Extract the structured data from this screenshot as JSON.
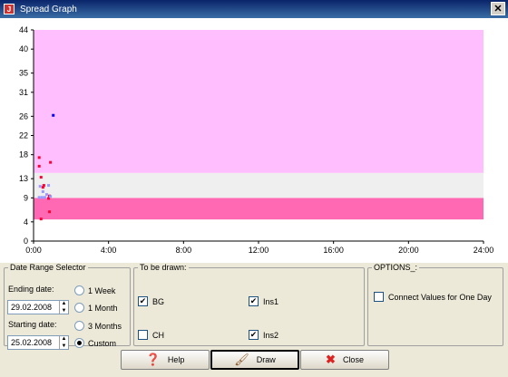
{
  "window": {
    "title": "Spread Graph",
    "app_icon": "java-cup-icon",
    "close_glyph": "✕"
  },
  "chart_data": {
    "type": "scatter",
    "title": "",
    "xlabel": "",
    "ylabel": "",
    "xlim": [
      0,
      24
    ],
    "ylim": [
      0,
      44
    ],
    "x_ticks": [
      "0:00",
      "4:00",
      "8:00",
      "12:00",
      "16:00",
      "20:00",
      "24:00"
    ],
    "y_ticks": [
      0,
      4,
      9,
      13,
      18,
      22,
      26,
      31,
      35,
      40,
      44
    ],
    "grid": false,
    "bands": [
      {
        "from": 0,
        "to": 4,
        "color": "#ffffff"
      },
      {
        "from": 4,
        "to": 4.5,
        "color": "#ffffff"
      },
      {
        "from": 4.5,
        "to": 9,
        "color": "#ff69b4"
      },
      {
        "from": 9,
        "to": 14.2,
        "color": "#efefef"
      },
      {
        "from": 14.2,
        "to": 44,
        "color": "#ffbfff"
      }
    ],
    "series": [
      {
        "color": "#ff0033",
        "points": [
          [
            0.3,
            17.4
          ],
          [
            0.3,
            15.6
          ],
          [
            0.4,
            13.3
          ],
          [
            0.5,
            11.2
          ],
          [
            0.55,
            11.6
          ],
          [
            0.9,
            16.4
          ],
          [
            0.8,
            8.9
          ],
          [
            0.85,
            6.1
          ],
          [
            0.4,
            4.6
          ],
          [
            0.85,
            9.4
          ]
        ]
      },
      {
        "color": "#9999ff",
        "points": [
          [
            0.35,
            11.4
          ],
          [
            0.5,
            10.3
          ],
          [
            0.3,
            9.1
          ],
          [
            0.45,
            9.1
          ],
          [
            0.6,
            9.1
          ],
          [
            0.8,
            11.6
          ],
          [
            0.7,
            9.7
          ],
          [
            0.9,
            9.3
          ]
        ]
      },
      {
        "color": "#0000ff",
        "points": [
          [
            1.05,
            26.2
          ]
        ]
      }
    ]
  },
  "date_range": {
    "legend": "Date Range Selector",
    "ending_label": "Ending date:",
    "ending_value": "29.02.2008",
    "starting_label": "Starting date:",
    "starting_value": "25.02.2008",
    "radios": [
      {
        "label": "1 Week",
        "checked": false
      },
      {
        "label": "1 Month",
        "checked": false
      },
      {
        "label": "3 Months",
        "checked": false
      },
      {
        "label": "Custom",
        "checked": true
      }
    ]
  },
  "to_draw": {
    "legend": "To be drawn:",
    "items": [
      {
        "label": "BG",
        "checked": true
      },
      {
        "label": "Ins1",
        "checked": true
      },
      {
        "label": "CH",
        "checked": false
      },
      {
        "label": "Ins2",
        "checked": true
      }
    ]
  },
  "options": {
    "legend": "OPTIONS_:",
    "connect_label": "Connect Values for One Day",
    "connect_checked": false
  },
  "buttons": {
    "help": "Help",
    "draw": "Draw",
    "close": "Close"
  },
  "icons": {
    "help": "help-icon",
    "draw": "paintbrush-icon",
    "close": "red-x-icon"
  }
}
